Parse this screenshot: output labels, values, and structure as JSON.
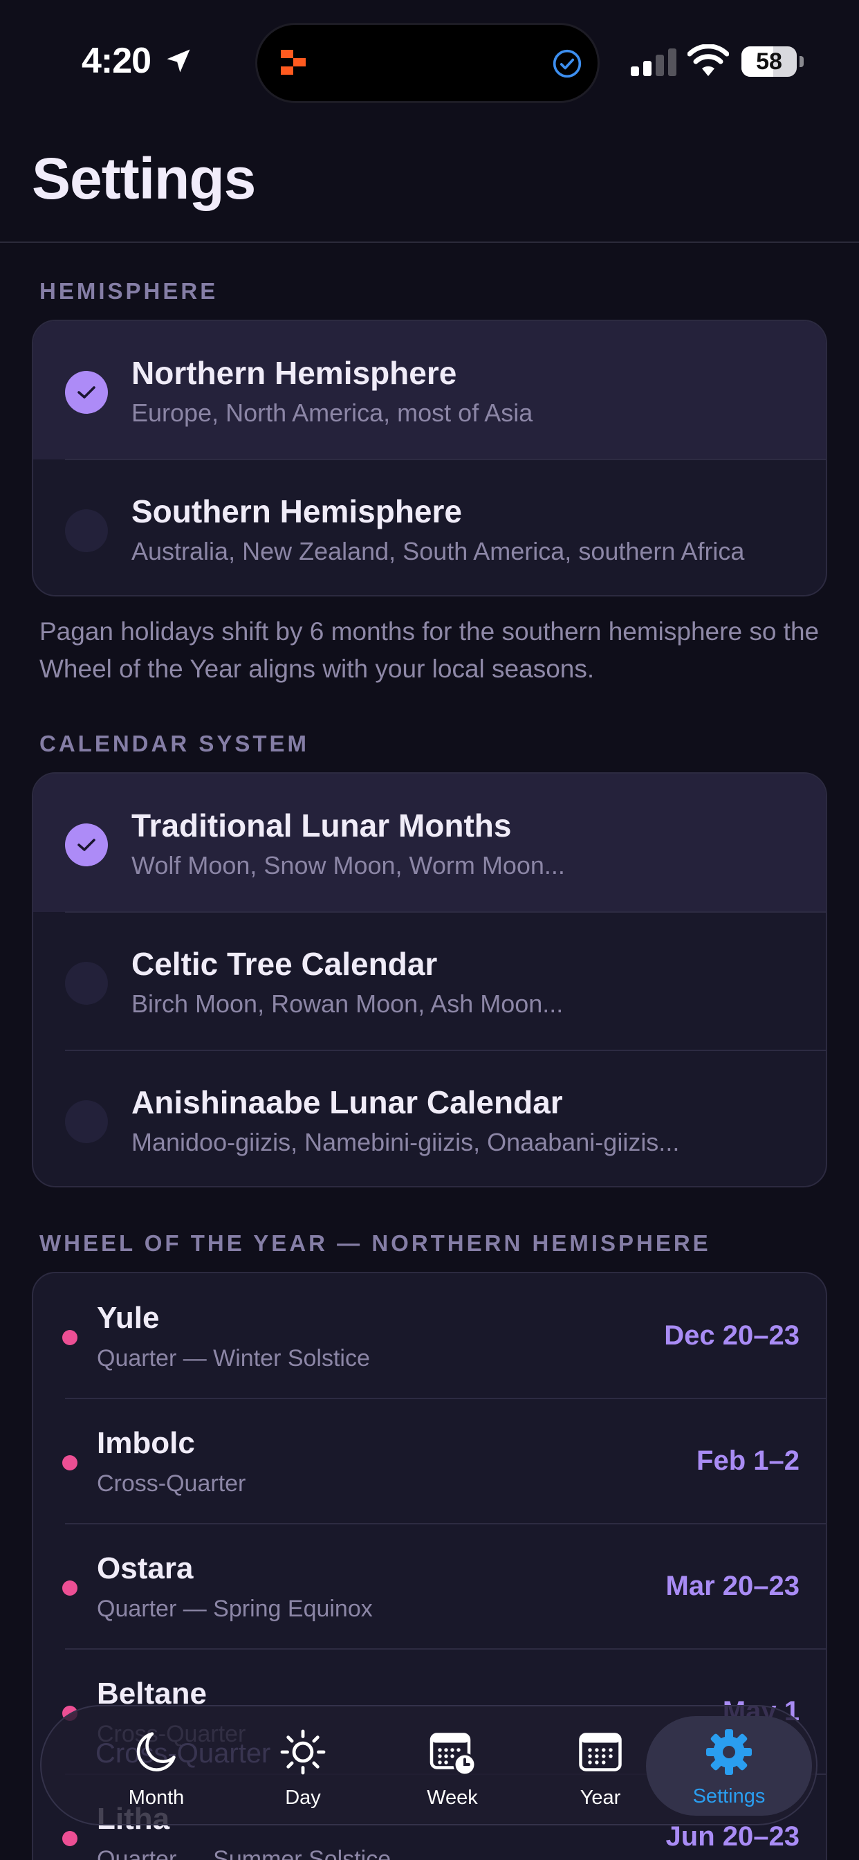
{
  "status_bar": {
    "time": "4:20",
    "battery_percent": 58,
    "battery_label": "58"
  },
  "header": {
    "title": "Settings"
  },
  "hemisphere": {
    "section_label": "HEMISPHERE",
    "options": [
      {
        "title": "Northern Hemisphere",
        "subtitle": "Europe, North America, most of Asia",
        "selected": true
      },
      {
        "title": "Southern Hemisphere",
        "subtitle": "Australia, New Zealand, South America, southern Africa",
        "selected": false
      }
    ],
    "footnote": "Pagan holidays shift by 6 months for the southern hemisphere so the Wheel of the Year aligns with your local seasons."
  },
  "calendar_system": {
    "section_label": "CALENDAR SYSTEM",
    "options": [
      {
        "title": "Traditional Lunar Months",
        "subtitle": "Wolf Moon, Snow Moon, Worm Moon...",
        "selected": true
      },
      {
        "title": "Celtic Tree Calendar",
        "subtitle": "Birch Moon, Rowan Moon, Ash Moon...",
        "selected": false
      },
      {
        "title": "Anishinaabe Lunar Calendar",
        "subtitle": "Manidoo-giizis, Namebini-giizis, Onaabani-giizis...",
        "selected": false
      }
    ]
  },
  "wheel_of_year": {
    "section_label": "WHEEL OF THE YEAR — NORTHERN HEMISPHERE",
    "items": [
      {
        "name": "Yule",
        "type": "Quarter — Winter Solstice",
        "date": "Dec 20–23"
      },
      {
        "name": "Imbolc",
        "type": "Cross-Quarter",
        "date": "Feb 1–2"
      },
      {
        "name": "Ostara",
        "type": "Quarter — Spring Equinox",
        "date": "Mar 20–23"
      },
      {
        "name": "Beltane",
        "type": "Cross-Quarter",
        "date": "May 1"
      },
      {
        "name": "Litha",
        "type": "Quarter — Summer Solstice",
        "date": "Jun 20–23"
      }
    ],
    "dot_color": "#ec4f94"
  },
  "tab_bar": {
    "tabs": [
      {
        "label": "Month",
        "icon": "moon-icon",
        "active": false
      },
      {
        "label": "Day",
        "icon": "sun-icon",
        "active": false
      },
      {
        "label": "Week",
        "icon": "calendar-clock-icon",
        "active": false
      },
      {
        "label": "Year",
        "icon": "calendar-grid-icon",
        "active": false
      },
      {
        "label": "Settings",
        "icon": "gear-icon",
        "active": true
      }
    ]
  },
  "colors": {
    "background": "#0f0e1a",
    "card": "#19182a",
    "selected_row": "#25223b",
    "accent_purple": "#ad8bf7",
    "date_purple": "#a98cf5",
    "active_tab_blue": "#2a9ef0"
  }
}
